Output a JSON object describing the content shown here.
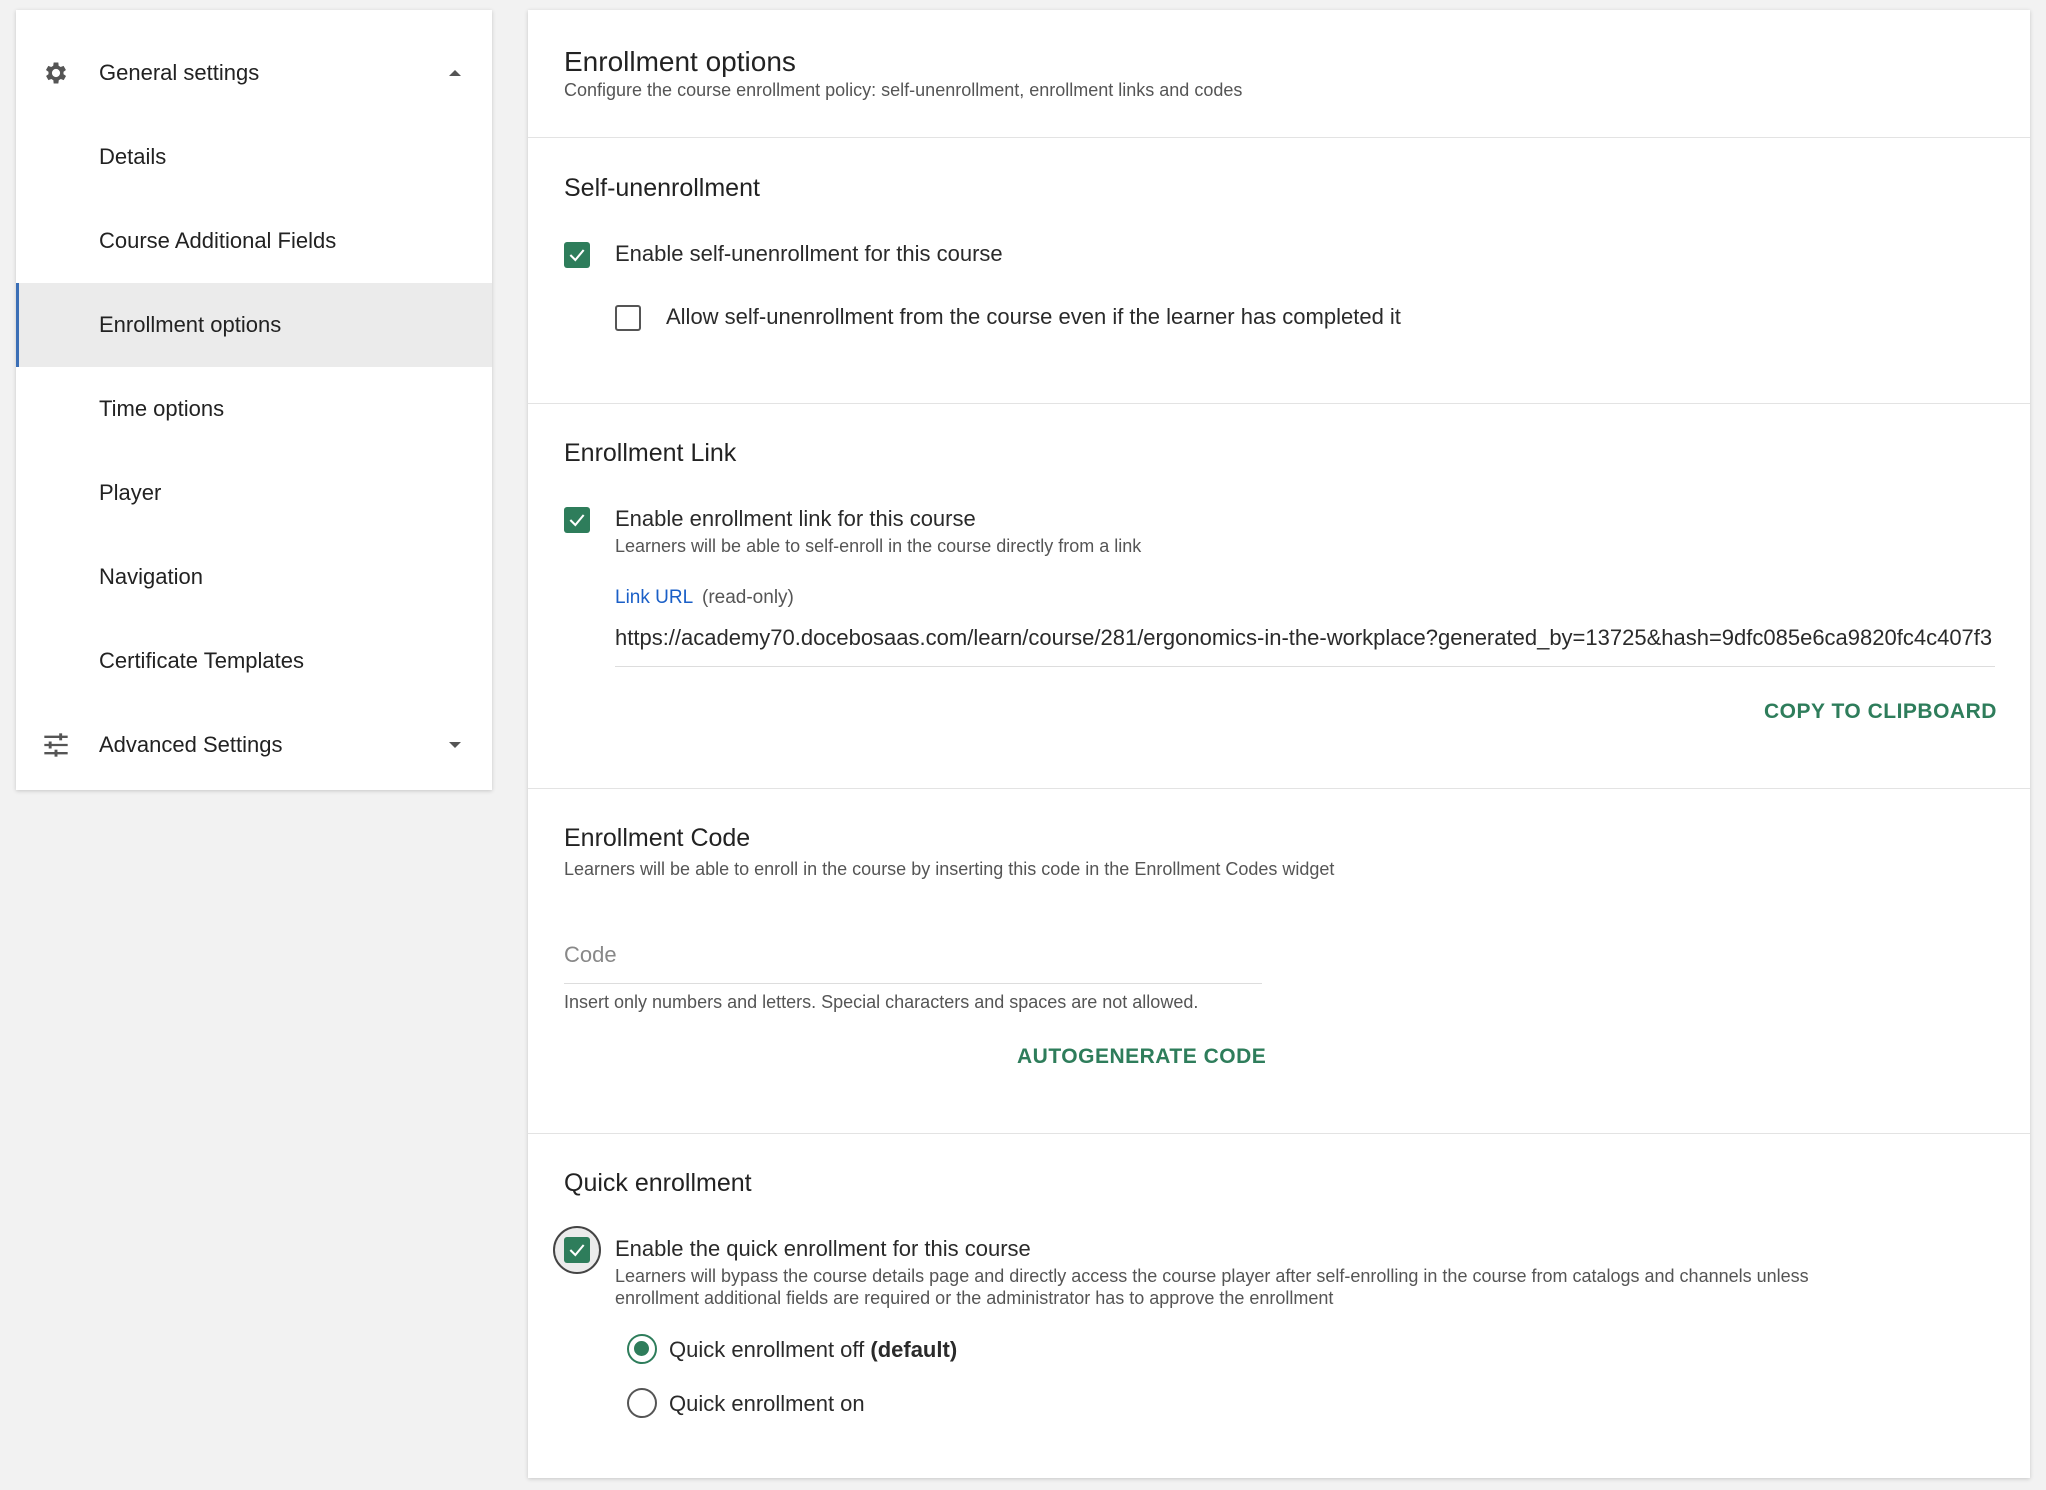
{
  "sidebar": {
    "general_settings": "General settings",
    "items": [
      {
        "label": "Details"
      },
      {
        "label": "Course Additional Fields"
      },
      {
        "label": "Enrollment options"
      },
      {
        "label": "Time options"
      },
      {
        "label": "Player"
      },
      {
        "label": "Navigation"
      },
      {
        "label": "Certificate Templates"
      }
    ],
    "advanced_settings": "Advanced Settings",
    "active_item": "Enrollment options"
  },
  "header": {
    "title": "Enrollment options",
    "subtitle": "Configure the course enrollment policy: self-unenrollment, enrollment links and codes"
  },
  "self_unenrollment": {
    "title": "Self-unenrollment",
    "enable_label": "Enable self-unenrollment for this course",
    "enable_checked": true,
    "allow_completed_label": "Allow self-unenrollment from the course even if the learner has completed it",
    "allow_completed_checked": false
  },
  "enrollment_link": {
    "title": "Enrollment Link",
    "enable_label": "Enable enrollment link for this course",
    "enable_checked": true,
    "enable_help": "Learners will be able to self-enroll in the course directly from a link",
    "url_label": "Link URL",
    "url_readonly": "(read-only)",
    "url_value": "https://academy70.docebosaas.com/learn/course/281/ergonomics-in-the-workplace?generated_by=13725&hash=9dfc085e6ca9820fc4c407f3",
    "copy_button": "COPY TO CLIPBOARD"
  },
  "enrollment_code": {
    "title": "Enrollment Code",
    "subtitle": "Learners will be able to enroll in the course by inserting this code in the Enrollment Codes widget",
    "code_placeholder": "Code",
    "code_help": "Insert only numbers and letters. Special characters and spaces are not allowed.",
    "autogenerate_button": "AUTOGENERATE CODE"
  },
  "quick_enrollment": {
    "title": "Quick enrollment",
    "enable_label": "Enable the quick enrollment for this course",
    "enable_checked": true,
    "enable_help_line1": "Learners will bypass the course details page and directly access the course player after self-enrolling in the course from catalogs and channels unless",
    "enable_help_line2": "enrollment additional fields are required or the administrator has to approve the enrollment",
    "option_off_label": "Quick enrollment off",
    "option_off_suffix": "(default)",
    "option_on_label": "Quick enrollment on",
    "selected": "off"
  },
  "colors": {
    "accent_green": "#2e7d5b",
    "link_blue": "#1a5fc7",
    "active_indicator": "#3b6fb6"
  }
}
